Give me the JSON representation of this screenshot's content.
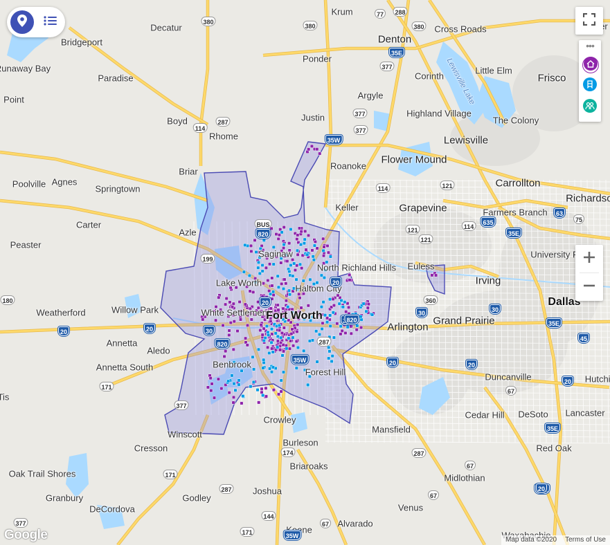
{
  "map": {
    "colors": {
      "land": "#ebeae5",
      "water": "#aadaff",
      "highway": "#fdd96b",
      "road": "#ffffff",
      "boundary_fill": "#8e8ee0",
      "boundary_stroke": "#4a4ab3",
      "marker_purple": "#8e24aa",
      "marker_blue": "#039be5"
    },
    "places": [
      {
        "name": "Decatur",
        "cls": "city"
      },
      {
        "name": "Krum",
        "cls": "city"
      },
      {
        "name": "Denton",
        "cls": "big"
      },
      {
        "name": "Cross Roads",
        "cls": "city"
      },
      {
        "name": "Prosper",
        "cls": "city"
      },
      {
        "name": "Bridgeport",
        "cls": "city"
      },
      {
        "name": "Ponder",
        "cls": "city"
      },
      {
        "name": "Little Elm",
        "cls": "city"
      },
      {
        "name": "Frisco",
        "cls": "big"
      },
      {
        "name": "Runaway Bay",
        "cls": "city"
      },
      {
        "name": "Paradise",
        "cls": "city"
      },
      {
        "name": "Corinth",
        "cls": "city"
      },
      {
        "name": "Argyle",
        "cls": "city"
      },
      {
        "name": "Highland Village",
        "cls": "city"
      },
      {
        "name": "Lewisville Lake",
        "cls": "water"
      },
      {
        "name": "Boyd",
        "cls": "city"
      },
      {
        "name": "Justin",
        "cls": "city"
      },
      {
        "name": "The Colony",
        "cls": "city"
      },
      {
        "name": "Rhome",
        "cls": "city"
      },
      {
        "name": "Lewisville",
        "cls": "big"
      },
      {
        "name": "Flower Mound",
        "cls": "big"
      },
      {
        "name": "Roanoke",
        "cls": "city"
      },
      {
        "name": "Briar",
        "cls": "city"
      },
      {
        "name": "Poolville",
        "cls": "city"
      },
      {
        "name": "Agnes",
        "cls": "city"
      },
      {
        "name": "Springtown",
        "cls": "city"
      },
      {
        "name": "Carrollton",
        "cls": "big"
      },
      {
        "name": "Keller",
        "cls": "city"
      },
      {
        "name": "Grapevine",
        "cls": "big"
      },
      {
        "name": "Farmers Branch",
        "cls": "city"
      },
      {
        "name": "Richardson",
        "cls": "big"
      },
      {
        "name": "Carter",
        "cls": "city"
      },
      {
        "name": "Azle",
        "cls": "city"
      },
      {
        "name": "Peaster",
        "cls": "city"
      },
      {
        "name": "Saginaw",
        "cls": "city"
      },
      {
        "name": "North Richland Hills",
        "cls": "city"
      },
      {
        "name": "Euless",
        "cls": "city"
      },
      {
        "name": "University Park",
        "cls": "city"
      },
      {
        "name": "Lake Worth",
        "cls": "city"
      },
      {
        "name": "Irving",
        "cls": "big"
      },
      {
        "name": "Haltom City",
        "cls": "city"
      },
      {
        "name": "Weatherford",
        "cls": "city"
      },
      {
        "name": "Willow Park",
        "cls": "city"
      },
      {
        "name": "Dallas",
        "cls": "huge"
      },
      {
        "name": "White Settlement",
        "cls": "city"
      },
      {
        "name": "Fort Worth",
        "cls": "huge"
      },
      {
        "name": "Arlington",
        "cls": "big"
      },
      {
        "name": "Grand Prairie",
        "cls": "big"
      },
      {
        "name": "Annetta",
        "cls": "city"
      },
      {
        "name": "Aledo",
        "cls": "city"
      },
      {
        "name": "Benbrook",
        "cls": "city"
      },
      {
        "name": "Annetta South",
        "cls": "city"
      },
      {
        "name": "Forest Hill",
        "cls": "city"
      },
      {
        "name": "Duncanville",
        "cls": "city"
      },
      {
        "name": "Hutchins",
        "cls": "city"
      },
      {
        "name": "Crowley",
        "cls": "city"
      },
      {
        "name": "Mansfield",
        "cls": "city"
      },
      {
        "name": "Cedar Hill",
        "cls": "city"
      },
      {
        "name": "DeSoto",
        "cls": "city"
      },
      {
        "name": "Lancaster",
        "cls": "city"
      },
      {
        "name": "Winscott",
        "cls": "city"
      },
      {
        "name": "Cresson",
        "cls": "city"
      },
      {
        "name": "Burleson",
        "cls": "city"
      },
      {
        "name": "Red Oak",
        "cls": "city"
      },
      {
        "name": "Oak Trail Shores",
        "cls": "city"
      },
      {
        "name": "Briaroaks",
        "cls": "city"
      },
      {
        "name": "Midlothian",
        "cls": "city"
      },
      {
        "name": "Granbury",
        "cls": "city"
      },
      {
        "name": "Godley",
        "cls": "city"
      },
      {
        "name": "Joshua",
        "cls": "city"
      },
      {
        "name": "DeCordova",
        "cls": "city"
      },
      {
        "name": "Venus",
        "cls": "city"
      },
      {
        "name": "Keene",
        "cls": "city"
      },
      {
        "name": "Alvarado",
        "cls": "city"
      },
      {
        "name": "Waxahachie",
        "cls": "city"
      },
      {
        "name": "Point",
        "cls": "city"
      },
      {
        "name": "Tis",
        "cls": "city"
      }
    ],
    "shields": [
      {
        "num": "77",
        "t": "us"
      },
      {
        "num": "288",
        "t": "us"
      },
      {
        "num": "380",
        "t": "us"
      },
      {
        "num": "380",
        "t": "us"
      },
      {
        "num": "380",
        "t": "us"
      },
      {
        "num": "35E",
        "t": "i"
      },
      {
        "num": "377",
        "t": "us"
      },
      {
        "num": "377",
        "t": "us"
      },
      {
        "num": "114",
        "t": "us"
      },
      {
        "num": "287",
        "t": "us"
      },
      {
        "num": "35W",
        "t": "i"
      },
      {
        "num": "377",
        "t": "us"
      },
      {
        "num": "114",
        "t": "us"
      },
      {
        "num": "121",
        "t": "us"
      },
      {
        "num": "121",
        "t": "us"
      },
      {
        "num": "635",
        "t": "i"
      },
      {
        "num": "114",
        "t": "us"
      },
      {
        "num": "121",
        "t": "us"
      },
      {
        "num": "35E",
        "t": "i"
      },
      {
        "num": "63",
        "t": "i"
      },
      {
        "num": "75",
        "t": "us"
      },
      {
        "num": "199",
        "t": "us"
      },
      {
        "num": "BUS",
        "t": "us"
      },
      {
        "num": "820",
        "t": "i"
      },
      {
        "num": "360",
        "t": "us"
      },
      {
        "num": "180",
        "t": "us"
      },
      {
        "num": "30",
        "t": "i"
      },
      {
        "num": "30",
        "t": "i"
      },
      {
        "num": "30",
        "t": "i"
      },
      {
        "num": "20",
        "t": "i"
      },
      {
        "num": "20",
        "t": "i"
      },
      {
        "num": "30",
        "t": "i"
      },
      {
        "num": "820",
        "t": "i"
      },
      {
        "num": "820",
        "t": "i"
      },
      {
        "num": "287",
        "t": "us"
      },
      {
        "num": "35W",
        "t": "i"
      },
      {
        "num": "35E",
        "t": "i"
      },
      {
        "num": "45",
        "t": "i"
      },
      {
        "num": "20",
        "t": "i"
      },
      {
        "num": "20",
        "t": "i"
      },
      {
        "num": "20",
        "t": "i"
      },
      {
        "num": "171",
        "t": "us"
      },
      {
        "num": "377",
        "t": "us"
      },
      {
        "num": "67",
        "t": "us"
      },
      {
        "num": "20",
        "t": "i"
      },
      {
        "num": "20",
        "t": "i"
      },
      {
        "num": "287",
        "t": "us"
      },
      {
        "num": "35E",
        "t": "i"
      },
      {
        "num": "174",
        "t": "us"
      },
      {
        "num": "171",
        "t": "us"
      },
      {
        "num": "287",
        "t": "us"
      },
      {
        "num": "67",
        "t": "us"
      },
      {
        "num": "67",
        "t": "us"
      },
      {
        "num": "35E",
        "t": "i"
      },
      {
        "num": "377",
        "t": "us"
      },
      {
        "num": "144",
        "t": "us"
      },
      {
        "num": "171",
        "t": "us"
      },
      {
        "num": "67",
        "t": "us"
      },
      {
        "num": "35W",
        "t": "i"
      },
      {
        "num": "20",
        "t": "i"
      }
    ],
    "controls": {
      "pin_icon": "map-pin-icon",
      "list_icon": "list-icon",
      "fullscreen_icon": "fullscreen-icon",
      "more_label": "•••",
      "layers": [
        {
          "name": "home-layer",
          "icon": "home-icon",
          "color": "#8e24aa"
        },
        {
          "name": "transit-layer",
          "icon": "transit-icon",
          "color": "#039be5"
        },
        {
          "name": "community-layer",
          "icon": "people-icon",
          "color": "#0db39e"
        }
      ],
      "zoom_in": "+",
      "zoom_out": "−"
    },
    "logo_text": "Google",
    "attribution": {
      "map_data": "Map data ©2020",
      "terms": "Terms of Use"
    }
  }
}
